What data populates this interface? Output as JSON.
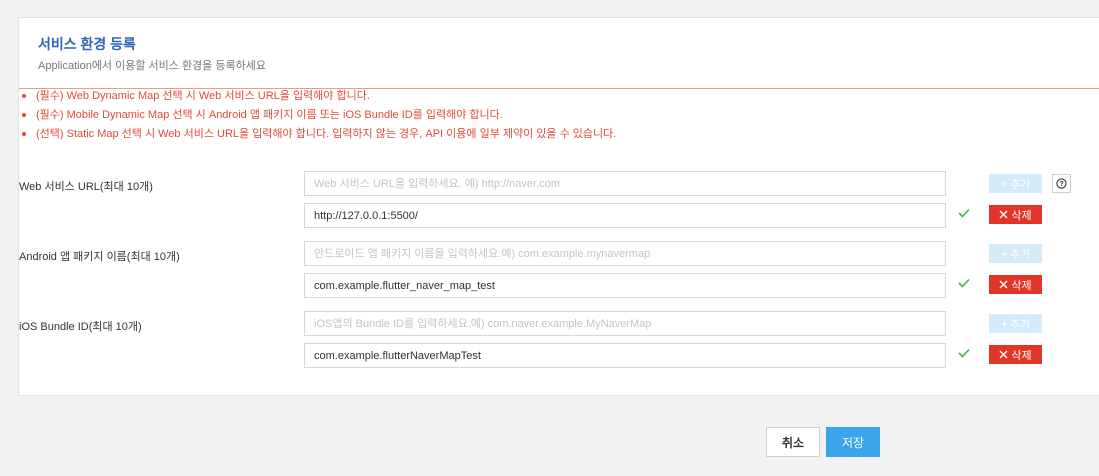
{
  "header": {
    "title": "서비스 환경 등록",
    "subtitle": "Application에서 이용할 서비스 환경을 등록하세요"
  },
  "notices": [
    "(필수) Web Dynamic Map 선택 시 Web 서비스 URL을 입력해야 합니다.",
    "(필수) Mobile Dynamic Map 선택 시 Android 앱 패키지 이름 또는 iOS Bundle ID를 입력해야 합니다.",
    "(선택) Static Map 선택 시 Web 서비스 URL을 입력해야 합니다. 입력하지 않는 경우, API 이용에 일부 제약이 있을 수 있습니다."
  ],
  "web": {
    "label": "Web 서비스 URL(최대 10개)",
    "placeholder": "Web 서비스 URL을 입력하세요. 예) http://naver.com",
    "value": "http://127.0.0.1:5500/"
  },
  "android": {
    "label": "Android 앱 패키지 이름(최대 10개)",
    "placeholder": "안드로이드 앱 패키지 이름을 입력하세요.예) com.example.mynavermap",
    "value": "com.example.flutter_naver_map_test"
  },
  "ios": {
    "label": "iOS Bundle ID(최대 10개)",
    "placeholder": "iOS앱의 Bundle ID를 입력하세요.예) com.naver.example.MyNaverMap",
    "value": "com.example.flutterNaverMapTest"
  },
  "buttons": {
    "add": "추가",
    "delete": "삭제",
    "help": "?",
    "cancel": "취소",
    "save": "저장"
  },
  "icons": {
    "add": "plus-icon",
    "delete": "close-icon",
    "valid": "check-icon",
    "help": "question-icon"
  },
  "colors": {
    "title": "#2d66b8",
    "notice": "#e34a3b",
    "add_button": "#d5ebfa",
    "delete_button": "#e2352a",
    "save_button": "#3ba6ec",
    "check": "#3cb54a"
  }
}
